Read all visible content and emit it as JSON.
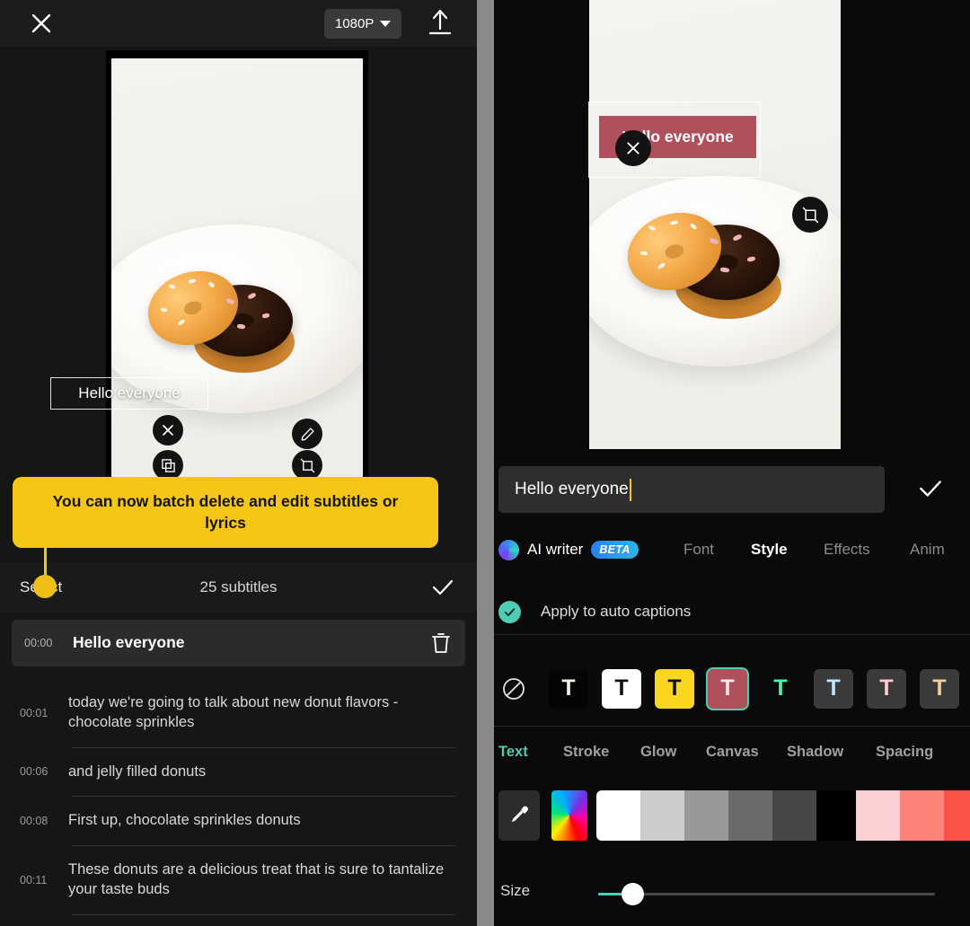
{
  "left": {
    "topbar": {
      "close_icon": "close-icon",
      "resolution_label": "1080P",
      "export_icon": "upload-icon"
    },
    "preview": {
      "caption_text": "Hello everyone",
      "handles": [
        "close-icon",
        "copy-icon",
        "edit-pencil-icon",
        "resize-rotate-icon"
      ]
    },
    "tooltip": {
      "text": "You can now batch delete and edit subtitles or lyrics"
    },
    "select_bar": {
      "select_label": "Select",
      "count_label": "25 subtitles",
      "confirm_icon": "check-icon"
    },
    "subtitles": [
      {
        "time": "00:00",
        "text": "Hello everyone",
        "active": true,
        "has_delete": true
      },
      {
        "time": "00:01",
        "text": "today we're going to talk about new donut flavors - chocolate sprinkles",
        "active": false
      },
      {
        "time": "00:06",
        "text": "and jelly filled donuts",
        "active": false
      },
      {
        "time": "00:08",
        "text": "First up, chocolate sprinkles donuts",
        "active": false
      },
      {
        "time": "00:11",
        "text": "These donuts are a delicious treat that is sure to tantalize your taste buds",
        "active": false
      }
    ]
  },
  "right": {
    "preview": {
      "caption_text": "Hello everyone",
      "caption_bg": "#b0505c",
      "handles": [
        "close-icon",
        "resize-rotate-icon"
      ]
    },
    "text_input": {
      "value": "Hello everyone",
      "confirm_icon": "check-icon"
    },
    "tabs": {
      "ai_writer_label": "AI writer",
      "beta_label": "BETA",
      "items": [
        {
          "label": "Font",
          "active": false
        },
        {
          "label": "Style",
          "active": true
        },
        {
          "label": "Effects",
          "active": false
        },
        {
          "label": "Anim",
          "active": false
        }
      ]
    },
    "apply": {
      "label": "Apply to auto captions",
      "checked": true,
      "accent": "#4ecdb4"
    },
    "presets": [
      {
        "name": "none",
        "glyph": "none",
        "bg": "transparent",
        "fg": "#ffffff",
        "selected": false
      },
      {
        "name": "black-white",
        "glyph": "T",
        "bg": "#050505",
        "fg": "#f5f2ea",
        "selected": false
      },
      {
        "name": "white-black",
        "glyph": "T",
        "bg": "#ffffff",
        "fg": "#111111",
        "selected": false
      },
      {
        "name": "yellow-black",
        "glyph": "T",
        "bg": "#fbd621",
        "fg": "#111111",
        "selected": false
      },
      {
        "name": "rose-white",
        "glyph": "T",
        "bg": "#b0505c",
        "fg": "#ffe8ea",
        "selected": true
      },
      {
        "name": "mint-dark",
        "glyph": "T",
        "bg": "#0b0b0b",
        "fg": "#4ff0b0",
        "selected": false
      },
      {
        "name": "blue-glow",
        "glyph": "T",
        "bg": "#3b3b3b",
        "fg": "#bfe4ff",
        "selected": false
      },
      {
        "name": "pink-glow",
        "glyph": "T",
        "bg": "#3b3b3b",
        "fg": "#ffc7cf",
        "selected": false
      },
      {
        "name": "gold-glow",
        "glyph": "T",
        "bg": "#3b3b3b",
        "fg": "#f0cf9a",
        "selected": false
      }
    ],
    "style_tabs": [
      {
        "label": "Text",
        "active": true
      },
      {
        "label": "Stroke",
        "active": false
      },
      {
        "label": "Glow",
        "active": false
      },
      {
        "label": "Canvas",
        "active": false
      },
      {
        "label": "Shadow",
        "active": false
      },
      {
        "label": "Spacing",
        "active": false
      }
    ],
    "colors": {
      "eyedropper_icon": "eyedropper-icon",
      "rainbow_name": "color-picker-swatch",
      "swatches": [
        "#ffffff",
        "#cccccc",
        "#989898",
        "#6b6b6b",
        "#474747",
        "#000000",
        "#fbd0d2",
        "#fc8379",
        "#fb5147",
        "#f8112e",
        "#fb0a0a"
      ]
    },
    "size": {
      "label": "Size",
      "value_pct": 9
    }
  }
}
